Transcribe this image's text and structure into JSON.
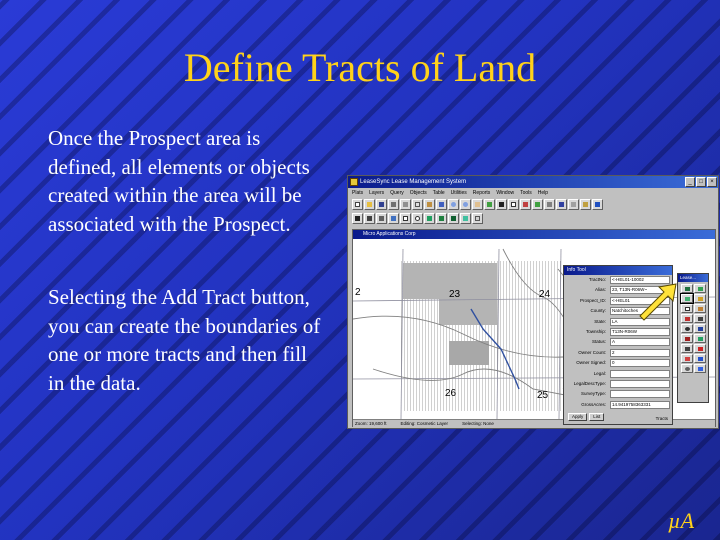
{
  "slide": {
    "title": "Define Tracts of Land",
    "paragraph1": "Once the Prospect area is defined, all elements or objects created within the area will be associated with the Prospect.",
    "paragraph2": "Selecting the Add Tract button, you can create the boundaries of one or more tracts and then fill in the data.",
    "logo": "µA",
    "colors": {
      "title": "#ffd21a",
      "text": "#ffffff",
      "background": "#2233c0",
      "arrow": "#ffe23a"
    }
  },
  "app": {
    "title": "LeaseSync   Lease Management System",
    "window_buttons": [
      "_",
      "□",
      "×"
    ],
    "menu": [
      "Plats",
      "Layers",
      "Query",
      "Objects",
      "Table",
      "Utilities",
      "Reports",
      "Window",
      "Tools",
      "Help"
    ],
    "inner_title": "Micro Applications Corp",
    "map_labels": {
      "sec_23": "23",
      "sec_24": "24",
      "sec_25": "25",
      "sec_26": "26",
      "sec_22": "2"
    },
    "status": [
      "Zoom: 19,600 ft",
      "Editing: Cosmetic Layer",
      "Selecting: None"
    ]
  },
  "info_tool": {
    "title": "Info Tool",
    "fields": [
      {
        "label": "TractNo:",
        "value": "<-HEL01-10002"
      },
      {
        "label": "Alias:",
        "value": "23,  T13N-R06W~"
      },
      {
        "label": "Prospect_ID:",
        "value": "<-HEL01"
      },
      {
        "label": "County:",
        "value": "Natchitoches"
      },
      {
        "label": "State:",
        "value": "LA"
      },
      {
        "label": "Township:",
        "value": "T13N-R06W"
      },
      {
        "label": "Status:",
        "value": "A"
      },
      {
        "label": "Owner Count:",
        "value": "2"
      },
      {
        "label": "Owner Signed:",
        "value": "0"
      },
      {
        "label": "Legal:",
        "value": ""
      },
      {
        "label": "LegalDescType:",
        "value": ""
      },
      {
        "label": "SurveyType:",
        "value": ""
      },
      {
        "label": "GrossAcres:",
        "value": "14.9419758363331"
      }
    ],
    "buttons": [
      "Apply",
      "List"
    ],
    "layer": "Tracts"
  },
  "palette": {
    "title": "Lease..."
  }
}
